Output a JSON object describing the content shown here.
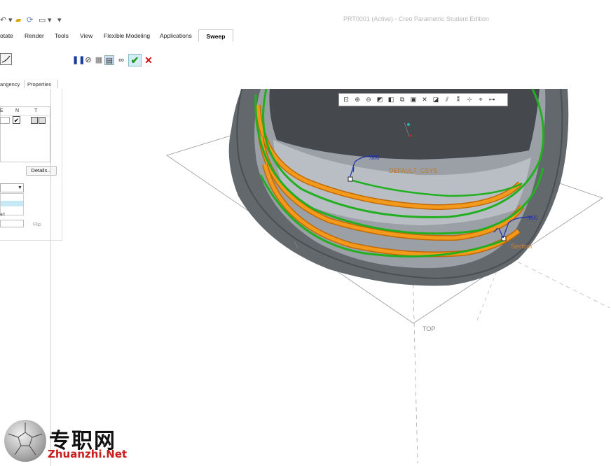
{
  "window": {
    "title": "PRT0001 (Active) - Creo Parametric Student Edition"
  },
  "ribbon": {
    "tabs": [
      "otate",
      "Render",
      "Tools",
      "View",
      "Flexible Modeling",
      "Applications"
    ],
    "active_tab": "Sweep"
  },
  "dashboard": {
    "sub_tabs": [
      "angency",
      "Properties"
    ],
    "references_table": {
      "headers": [
        "E",
        "N",
        "T"
      ]
    },
    "details_label": "Details...",
    "flip_label": "Flip",
    "list_item_3": "ari"
  },
  "viewport": {
    "labels": {
      "default_csys": "DEFAULT_CSYS",
      "top_plane": "TOP",
      "right_plane": "RIGHT",
      "section": "Section"
    }
  },
  "watermark": {
    "text": "专职网",
    "url": "Zhuanzhi.Net"
  },
  "colors": {
    "accent_green": "#22b022",
    "sweep_orange": "#f39a1c",
    "body_gray": "#6e7378",
    "cancel_red": "#d01010"
  }
}
